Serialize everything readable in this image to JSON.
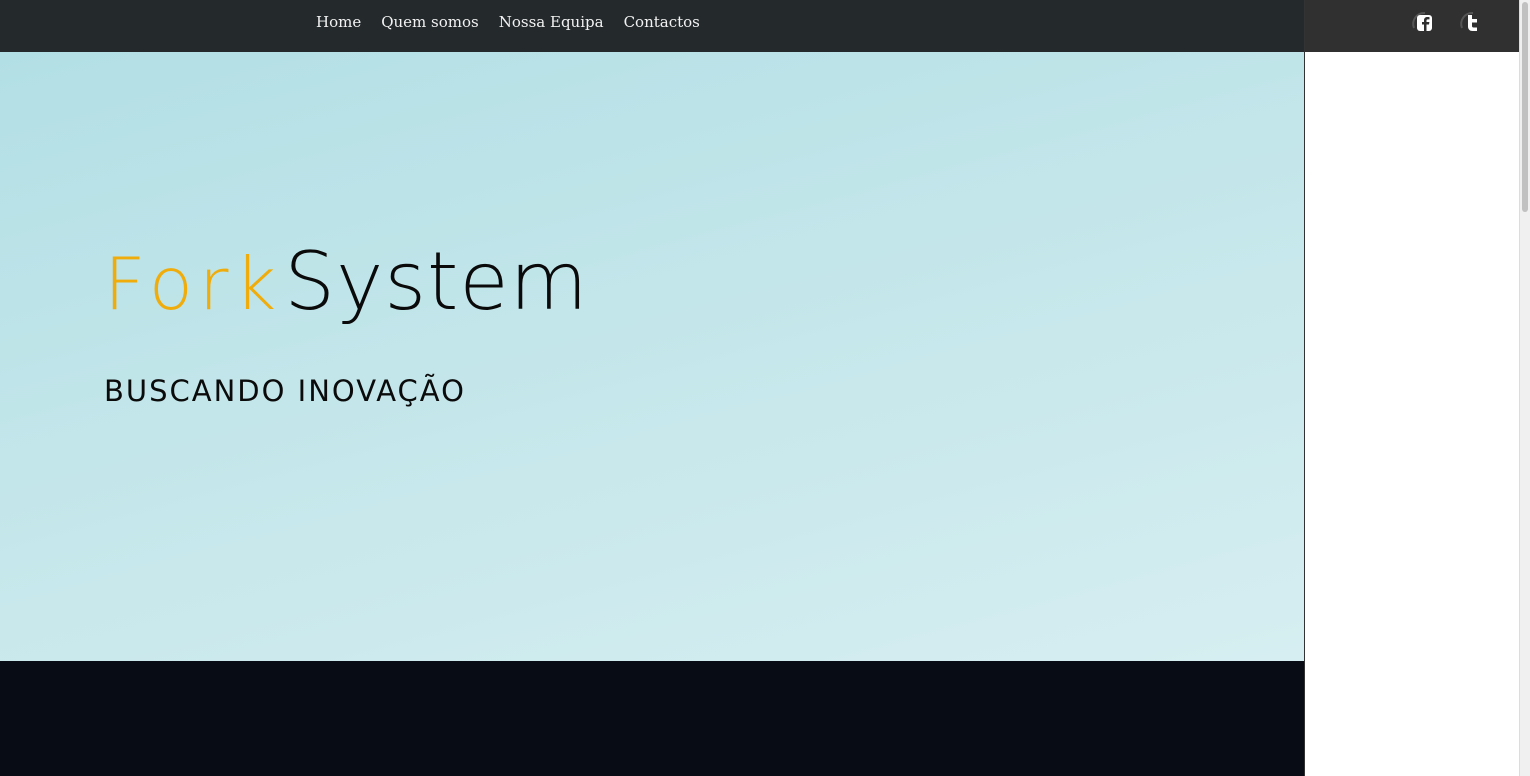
{
  "nav": {
    "items": [
      {
        "label": "Home"
      },
      {
        "label": "Quem somos"
      },
      {
        "label": "Nossa Equipa"
      },
      {
        "label": "Contactos"
      }
    ]
  },
  "hero": {
    "logo_part1": "Fork",
    "logo_part2": "System",
    "tagline": "BUSCANDO INOVAÇÃO"
  },
  "social": {
    "icons": [
      "facebook-icon",
      "twitter-icon"
    ]
  },
  "colors": {
    "nav_bg": "#24292c",
    "logo_accent": "#f0ac0a",
    "hero_bg": "#c3e6ea",
    "dark_band": "#070c15",
    "side_top": "#303030"
  }
}
